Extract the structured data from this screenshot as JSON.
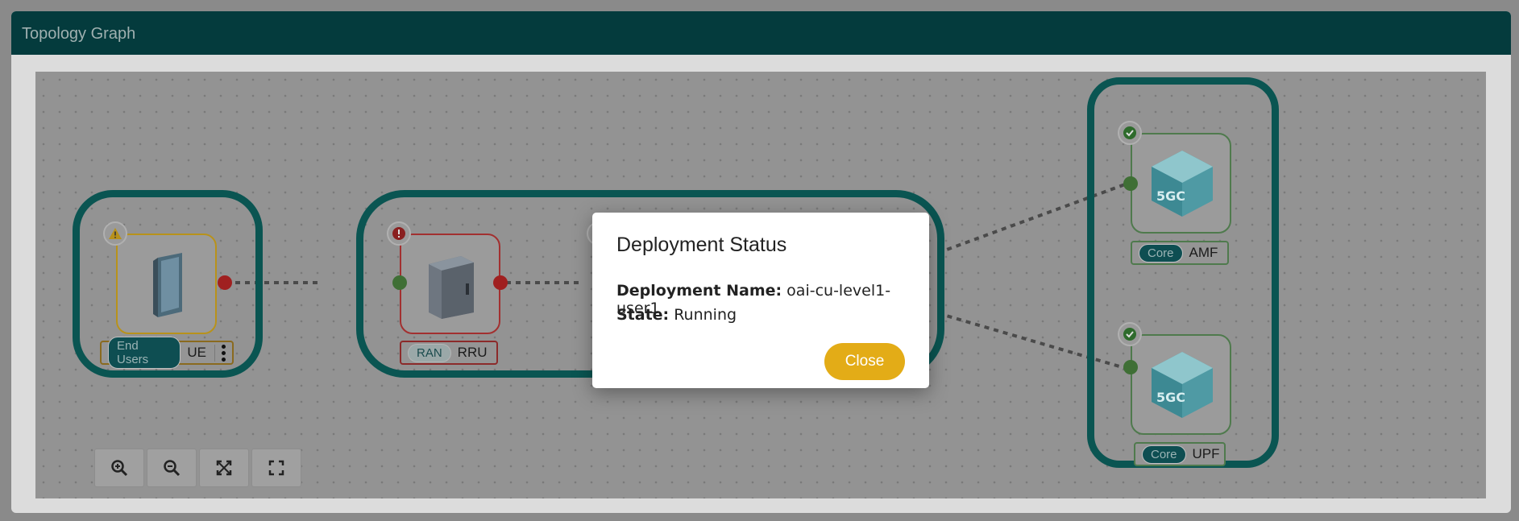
{
  "panel": {
    "title": "Topology Graph"
  },
  "nodes": {
    "ue": {
      "tag": "End Users",
      "name": "UE"
    },
    "rru": {
      "tag": "RAN",
      "name": "RRU"
    },
    "amf": {
      "tag": "Core",
      "name": "AMF"
    },
    "upf": {
      "tag": "Core",
      "name": "UPF"
    }
  },
  "toolbar": {
    "zoom_in": "zoom-in-icon",
    "zoom_out": "zoom-out-icon",
    "fit": "fit-view-icon",
    "fullscreen": "fullscreen-icon"
  },
  "modal": {
    "title": "Deployment Status",
    "name_label": "Deployment Name:",
    "name_value": "oai-cu-level1-user1",
    "state_label": "State:",
    "state_value": "Running",
    "close_label": "Close"
  },
  "colors": {
    "header": "#043b3d",
    "group_border": "#0a5552",
    "warn": "#e0b020",
    "error": "#b02020",
    "ok": "#2e7d32",
    "close_button": "#e3ac17"
  }
}
